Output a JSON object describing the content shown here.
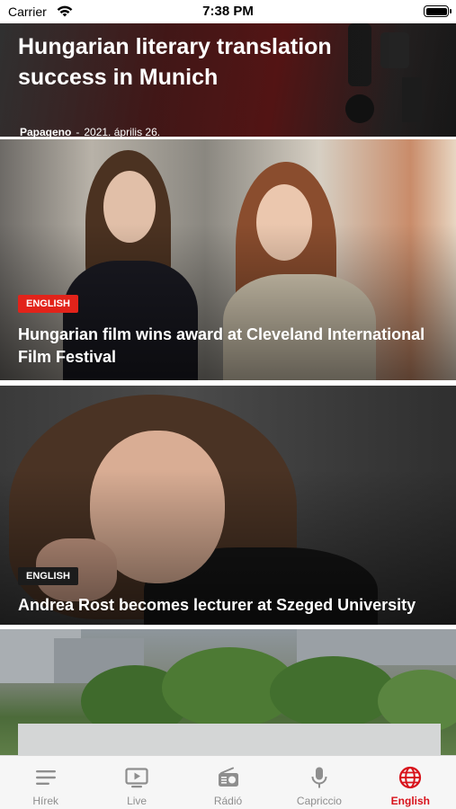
{
  "status_bar": {
    "carrier": "Carrier",
    "time": "7:38 PM"
  },
  "feed": {
    "articles": [
      {
        "title": "Hungarian literary translation success in Munich",
        "author": "Papageno",
        "separator": "-",
        "date": "2021. április 26."
      },
      {
        "tag": "ENGLISH",
        "tag_color": "#e2231a",
        "title": "Hungarian film wins award at Cleveland International Film Festival"
      },
      {
        "tag": "ENGLISH",
        "tag_color": "#1c1c1c",
        "title": "Andrea Rost becomes lecturer at Szeged University"
      },
      {
        "image": "building-with-rooftop-garden"
      }
    ]
  },
  "tab_bar": {
    "active_color": "#d8121b",
    "inactive_color": "#8e8e8e",
    "tabs": [
      {
        "label": "Hírek",
        "icon": "list-icon"
      },
      {
        "label": "Live",
        "icon": "tv-play-icon"
      },
      {
        "label": "Rádió",
        "icon": "radio-icon"
      },
      {
        "label": "Capriccio",
        "icon": "microphone-icon"
      },
      {
        "label": "English",
        "icon": "globe-icon",
        "active": true
      }
    ]
  }
}
